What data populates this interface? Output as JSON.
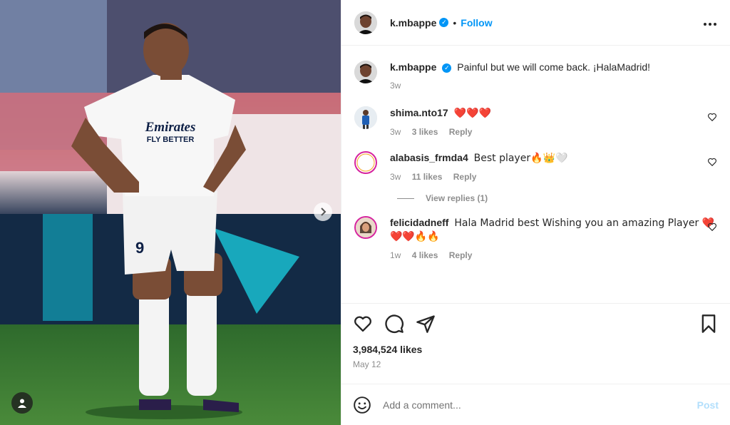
{
  "post": {
    "username": "k.mbappe",
    "follow_label": "Follow",
    "dot": "•",
    "verified_mark": "✓",
    "caption": "Painful but we will come back. ¡HalaMadrid!",
    "caption_age": "3w",
    "likes": "3,984,524 likes",
    "date": "May 12"
  },
  "comments": [
    {
      "username": "shima.nto17",
      "text": "❤️❤️❤️",
      "age": "3w",
      "likes": "3 likes",
      "reply": "Reply"
    },
    {
      "username": "alabasis_frmda4",
      "text": "Best player🔥👑🤍",
      "age": "3w",
      "likes": "11 likes",
      "reply": "Reply",
      "view_replies": "View replies (1)"
    },
    {
      "username": "felicidadneff",
      "text": "Hala Madrid best Wishing you an amazing Player ❤️❤️❤️🔥🔥",
      "age": "1w",
      "likes": "4 likes",
      "reply": "Reply"
    }
  ],
  "add_comment": {
    "placeholder": "Add a comment...",
    "post_label": "Post"
  },
  "media": {
    "shirt_sponsor": "Emirates",
    "shirt_tagline": "FLY BETTER",
    "shirt_number": "9"
  },
  "icons": {
    "more": "more-options-icon",
    "like": "heart-icon",
    "comment": "comment-icon",
    "share": "share-icon",
    "save": "bookmark-icon",
    "emoji": "emoji-icon",
    "next": "chevron-right-icon",
    "tags": "user-tag-icon"
  },
  "colors": {
    "accent": "#0095f6",
    "post_disabled": "#b2dffc",
    "muted": "#8e8e8e"
  }
}
